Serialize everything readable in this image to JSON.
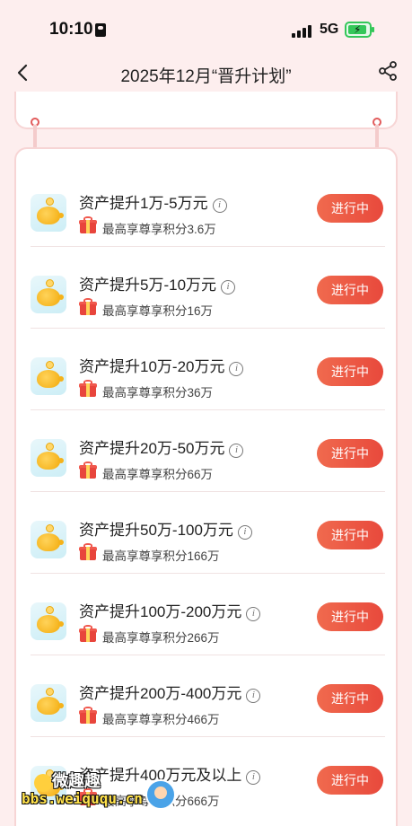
{
  "status_bar": {
    "time": "10:10",
    "network": "5G"
  },
  "nav": {
    "title": "2025年12月“晋升计划”",
    "back_icon": "chevron-left-icon",
    "share_icon": "share-icon"
  },
  "tiers": [
    {
      "title": "资产提升1万-5万元",
      "reward": "最高享尊享积分3.6万",
      "status": "进行中"
    },
    {
      "title": "资产提升5万-10万元",
      "reward": "最高享尊享积分16万",
      "status": "进行中"
    },
    {
      "title": "资产提升10万-20万元",
      "reward": "最高享尊享积分36万",
      "status": "进行中"
    },
    {
      "title": "资产提升20万-50万元",
      "reward": "最高享尊享积分66万",
      "status": "进行中"
    },
    {
      "title": "资产提升50万-100万元",
      "reward": "最高享尊享积分166万",
      "status": "进行中"
    },
    {
      "title": "资产提升100万-200万元",
      "reward": "最高享尊享积分266万",
      "status": "进行中"
    },
    {
      "title": "资产提升200万-400万元",
      "reward": "最高享尊享积分466万",
      "status": "进行中"
    },
    {
      "title": "资产提升400万元及以上",
      "reward": "最高享尊享积分666万",
      "status": "进行中"
    }
  ],
  "watermark": {
    "title": "微趣趣",
    "url": "bbs.weiququ.cn"
  },
  "colors": {
    "accent": "#e8493c",
    "background": "#fdeeee",
    "battery": "#34c759"
  }
}
